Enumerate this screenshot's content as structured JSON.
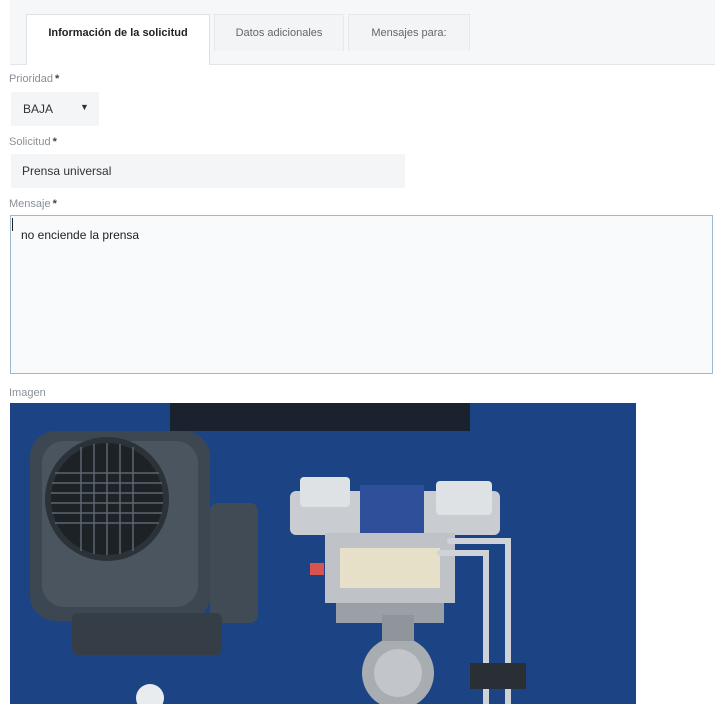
{
  "tabs": [
    {
      "label": "Información de la solicitud",
      "active": true
    },
    {
      "label": "Datos adicionales",
      "active": false
    },
    {
      "label": "Mensajes para:",
      "active": false
    }
  ],
  "form": {
    "required_mark": "*",
    "priority": {
      "label": "Prioridad",
      "value": "BAJA"
    },
    "request": {
      "label": "Solicitud",
      "value": "Prensa universal"
    },
    "message": {
      "label": "Mensaje",
      "value": "no enciende la prensa"
    },
    "image": {
      "label": "Imagen"
    }
  },
  "colors": {
    "accent_border": "#9fb8cc",
    "photo_background": "#1f4b8e"
  },
  "icons": {
    "select_caret": "chevron-down-icon"
  }
}
